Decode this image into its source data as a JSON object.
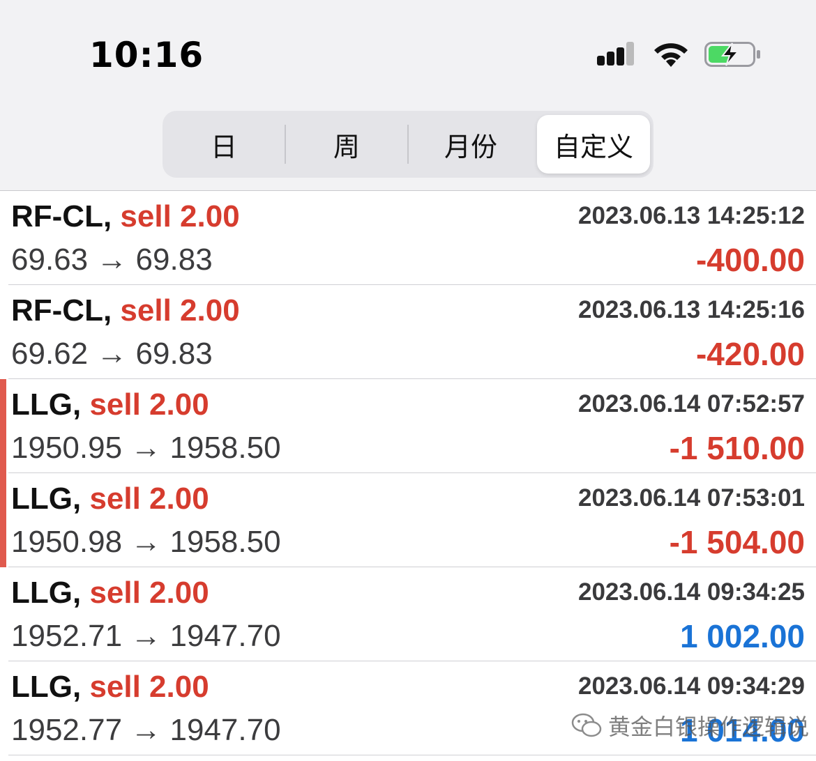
{
  "status_bar": {
    "time": "10:16"
  },
  "segments": [
    {
      "label": "日"
    },
    {
      "label": "周"
    },
    {
      "label": "月份"
    },
    {
      "label": "自定义",
      "selected": true
    }
  ],
  "trades": [
    {
      "symbol": "RF-CL,",
      "side": "sell 2.00",
      "time": "2023.06.13 14:25:12",
      "price": "69.63 → 69.83",
      "profit": "-400.00",
      "profit_type": "negative",
      "marked": false
    },
    {
      "symbol": "RF-CL,",
      "side": "sell 2.00",
      "time": "2023.06.13 14:25:16",
      "price": "69.62 → 69.83",
      "profit": "-420.00",
      "profit_type": "negative",
      "marked": false
    },
    {
      "symbol": "LLG,",
      "side": "sell 2.00",
      "time": "2023.06.14 07:52:57",
      "price": "1950.95 → 1958.50",
      "profit": "-1 510.00",
      "profit_type": "negative",
      "marked": true
    },
    {
      "symbol": "LLG,",
      "side": "sell 2.00",
      "time": "2023.06.14 07:53:01",
      "price": "1950.98 → 1958.50",
      "profit": "-1 504.00",
      "profit_type": "negative",
      "marked": true
    },
    {
      "symbol": "LLG,",
      "side": "sell 2.00",
      "time": "2023.06.14 09:34:25",
      "price": "1952.71 → 1947.70",
      "profit": "1 002.00",
      "profit_type": "positive",
      "marked": false
    },
    {
      "symbol": "LLG,",
      "side": "sell 2.00",
      "time": "2023.06.14 09:34:29",
      "price": "1952.77 → 1947.70",
      "profit": "1 014.00",
      "profit_type": "positive",
      "marked": false
    }
  ],
  "watermark": {
    "text": "黄金白银操作逻辑说"
  },
  "colors": {
    "negative": "#d63c2e",
    "positive": "#1a73d6",
    "marker": "#e05a4e"
  }
}
